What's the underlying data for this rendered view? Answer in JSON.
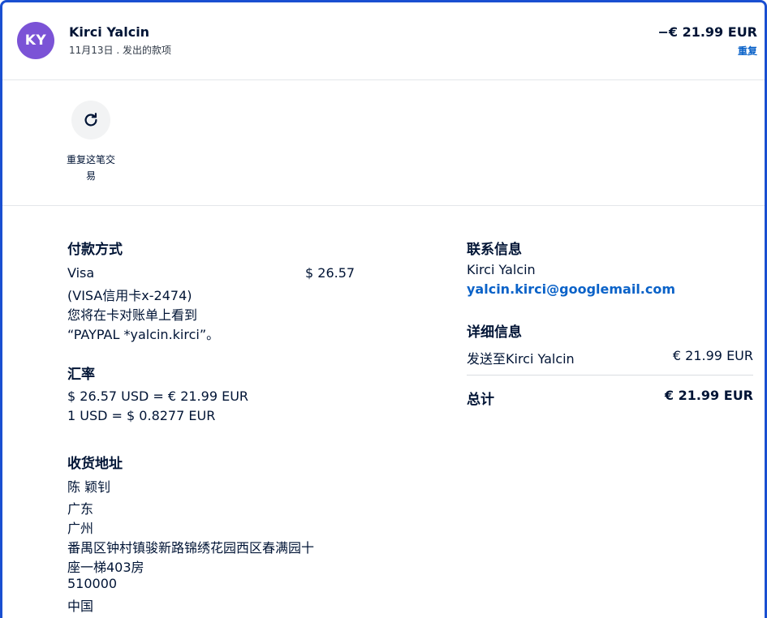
{
  "header": {
    "avatar_initials": "KY",
    "name": "Kirci Yalcin",
    "subtitle": "11月13日 . 发出的款项",
    "amount": "−€ 21.99 EUR",
    "repeat_link": "重复"
  },
  "actions": {
    "repeat_icon": "refresh-icon",
    "repeat_label": "重复这笔交易"
  },
  "payment": {
    "title": "付款方式",
    "card_name": "Visa",
    "card_detail": "(VISA信用卡x-2474)",
    "statement_note_1": "您将在卡对账单上看到",
    "statement_note_2": "“PAYPAL *yalcin.kirci”。",
    "amount": "$ 26.57"
  },
  "exchange": {
    "title": "汇率",
    "line_1": "$ 26.57 USD = € 21.99 EUR",
    "line_2": "1 USD = $ 0.8277 EUR"
  },
  "shipping": {
    "title": "收货地址",
    "name": "陈 颖钊",
    "province": "广东",
    "city": "广州",
    "street_1": "番禺区钟村镇骏新路锦绣花园西区春满园十",
    "street_2": "座一梯403房",
    "postal_code": "510000",
    "country": "中国"
  },
  "contact": {
    "title": "联系信息",
    "name": "Kirci Yalcin",
    "email": "yalcin.kirci@googlemail.com"
  },
  "details": {
    "title": "详细信息",
    "sent_to_label": "发送至Kirci Yalcin",
    "sent_to_amount": "€ 21.99 EUR",
    "total_label": "总计",
    "total_amount": "€ 21.99 EUR"
  },
  "colors": {
    "accent_border": "#1a4fd1",
    "link": "#0a62c8",
    "avatar": "#7b53d6",
    "text": "#001435"
  }
}
